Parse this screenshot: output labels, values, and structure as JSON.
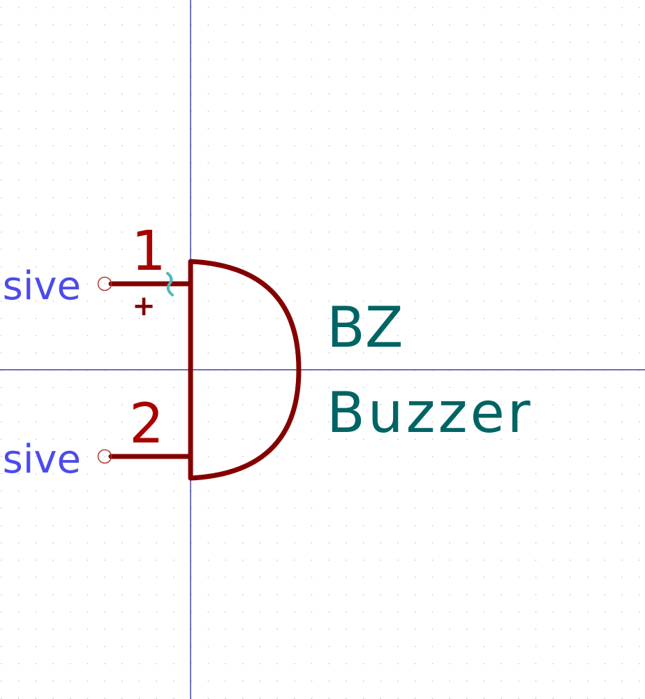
{
  "editor": {
    "colors": {
      "background": "#ffffff",
      "grid_dot": "#b8b8b8",
      "axis": "#1a1a8c",
      "body": "#840000",
      "pin_number": "#a90000",
      "pin_electrical_type": "#4b4bee",
      "pin_end_circle": "#b03a2e",
      "field": "#006464",
      "unit_highlight": "#4fb8b8"
    }
  },
  "symbol": {
    "reference": "BZ",
    "value": "Buzzer",
    "pins": [
      {
        "number": "1",
        "electrical_type": "sive",
        "polarity_marker": "+"
      },
      {
        "number": "2",
        "electrical_type": "sive",
        "polarity_marker": ""
      }
    ]
  }
}
